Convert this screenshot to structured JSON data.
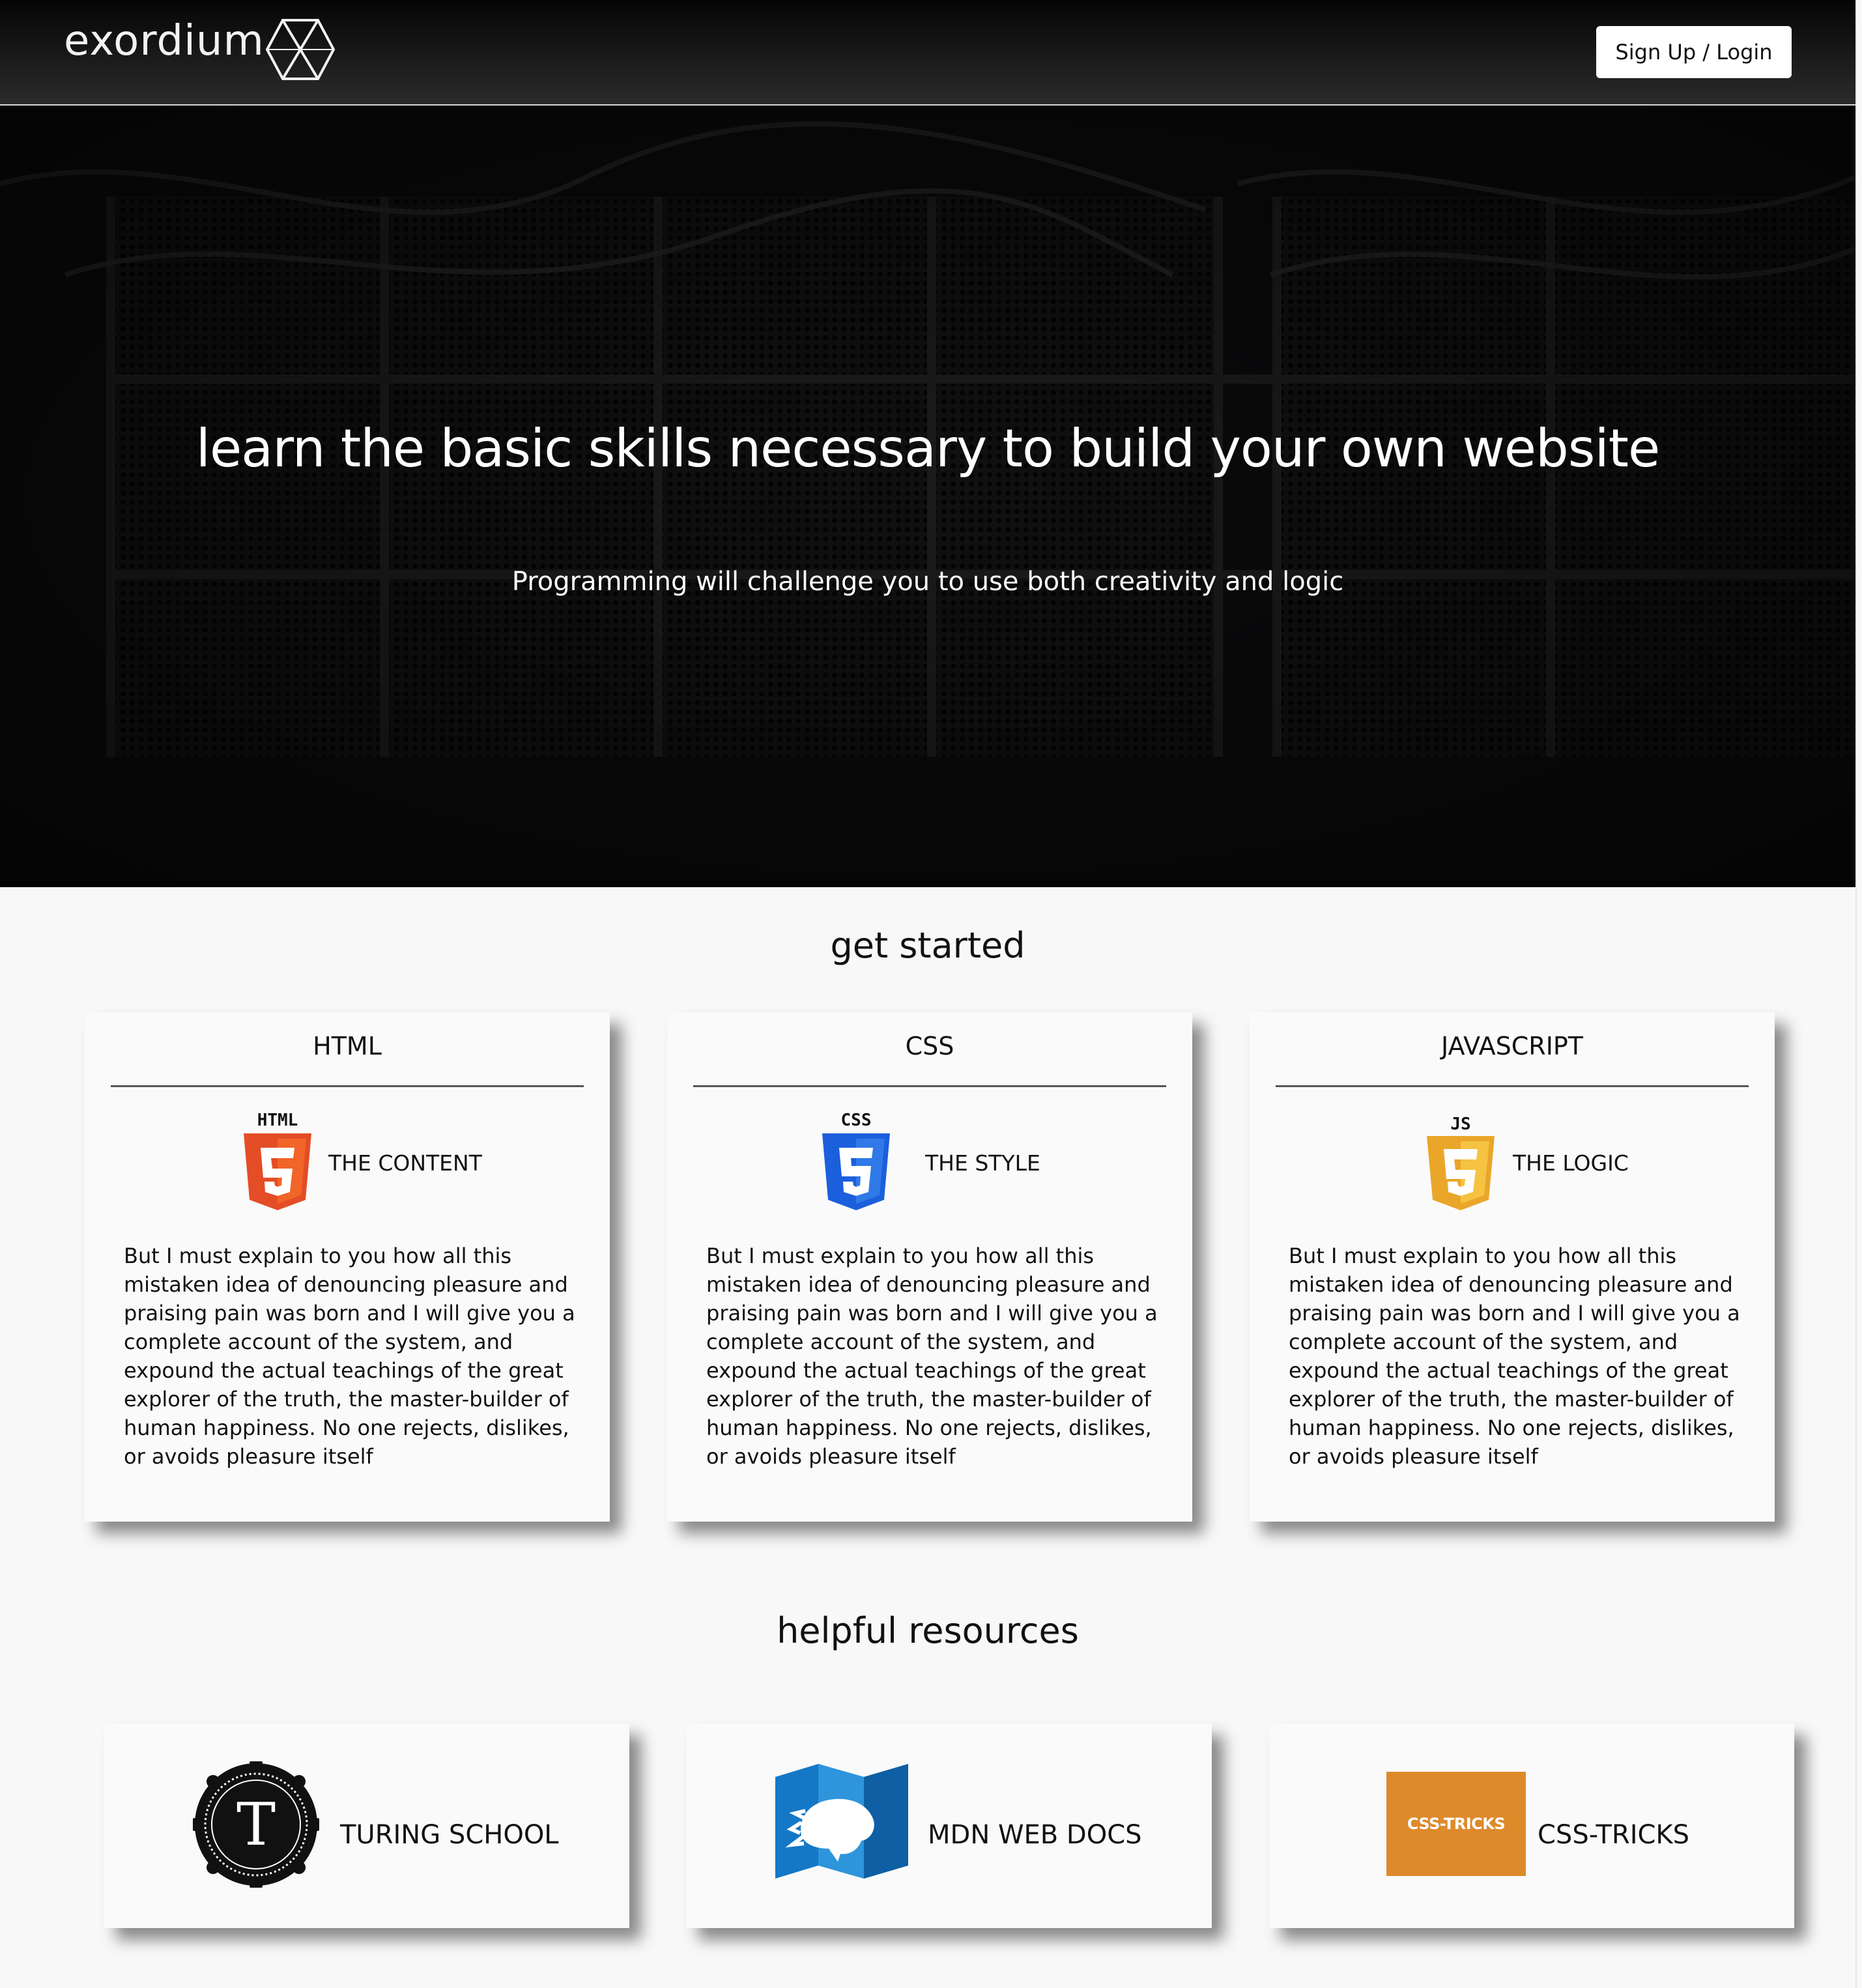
{
  "header": {
    "logo_text": "exordium",
    "signup_label": "Sign Up / Login"
  },
  "hero": {
    "title": "learn the basic skills necessary to build your own website",
    "subtitle": "Programming will challenge you to use both creativity and logic"
  },
  "get_started": {
    "title": "get started",
    "cards": [
      {
        "title": "HTML",
        "badge": "HTML",
        "tag": "THE CONTENT",
        "text": "But I must explain to you how all this mistaken idea of denouncing pleasure and praising pain was born and I will give you a complete account of the system, and expound the actual teachings of the great explorer of the truth, the master-builder of human happiness. No one rejects, dislikes, or avoids pleasure itself"
      },
      {
        "title": "CSS",
        "badge": "CSS",
        "tag": "THE STYLE",
        "text": "But I must explain to you how all this mistaken idea of denouncing pleasure and praising pain was born and I will give you a complete account of the system, and expound the actual teachings of the great explorer of the truth, the master-builder of human happiness. No one rejects, dislikes, or avoids pleasure itself"
      },
      {
        "title": "JAVASCRIPT",
        "badge": "JS",
        "tag": "THE LOGIC",
        "text": "But I must explain to you how all this mistaken idea of denouncing pleasure and praising pain was born and I will give you a complete account of the system, and expound the actual teachings of the great explorer of the truth, the master-builder of human happiness. No one rejects, dislikes, or avoids pleasure itself"
      }
    ]
  },
  "resources": {
    "title": "helpful resources",
    "items": [
      {
        "label": "TURING SCHOOL",
        "logo_letter": "T"
      },
      {
        "label": "MDN WEB DOCS"
      },
      {
        "label": "CSS-TRICKS",
        "logo_text": "CSS-TRICKS"
      }
    ]
  },
  "colors": {
    "html_orange": "#e44d26",
    "css_blue": "#1b5fdc",
    "js_yellow": "#e9a629",
    "mdn_blue": "#1478c6",
    "css_tricks_orange": "#dd8a2b"
  },
  "icons": [
    "exordium-hexagon-icon",
    "html5-shield-icon",
    "css3-shield-icon",
    "js-shield-icon",
    "turing-badge-icon",
    "mdn-map-icon",
    "css-tricks-logo-icon"
  ]
}
